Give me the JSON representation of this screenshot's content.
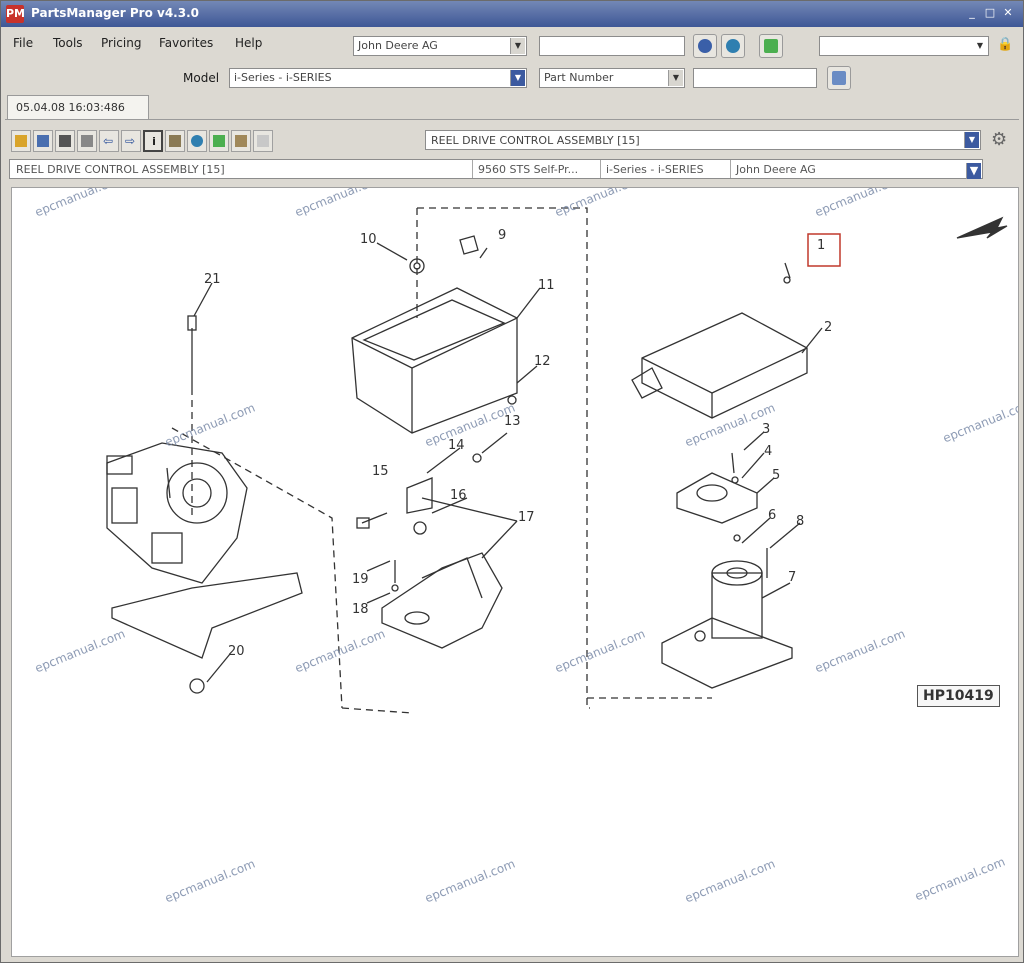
{
  "window": {
    "title": "PartsManager Pro v4.3.0"
  },
  "menu": [
    "File",
    "Tools",
    "Pricing",
    "Favorites",
    "Help"
  ],
  "search": {
    "dealer_value": "John Deere AG",
    "search_value": "",
    "model_label": "Model",
    "model_value": "i-Series - i-SERIES",
    "search_by_value": "Part Number",
    "part_value": "",
    "right_value": ""
  },
  "tab": {
    "label": "05.04.08 16:03:486"
  },
  "assembly": {
    "selected": "REEL DRIVE CONTROL ASSEMBLY [15]",
    "info": [
      "REEL DRIVE CONTROL ASSEMBLY [15]",
      "9560 STS Self-Pr...",
      "i-Series - i-SERIES",
      "John Deere AG"
    ]
  },
  "diagram": {
    "figure_id": "HP10419",
    "callouts": [
      "1",
      "2",
      "3",
      "4",
      "5",
      "6",
      "7",
      "8",
      "9",
      "10",
      "11",
      "12",
      "13",
      "14",
      "15",
      "16",
      "17",
      "18",
      "19",
      "20",
      "21"
    ],
    "watermark": "epcmanual.com"
  }
}
